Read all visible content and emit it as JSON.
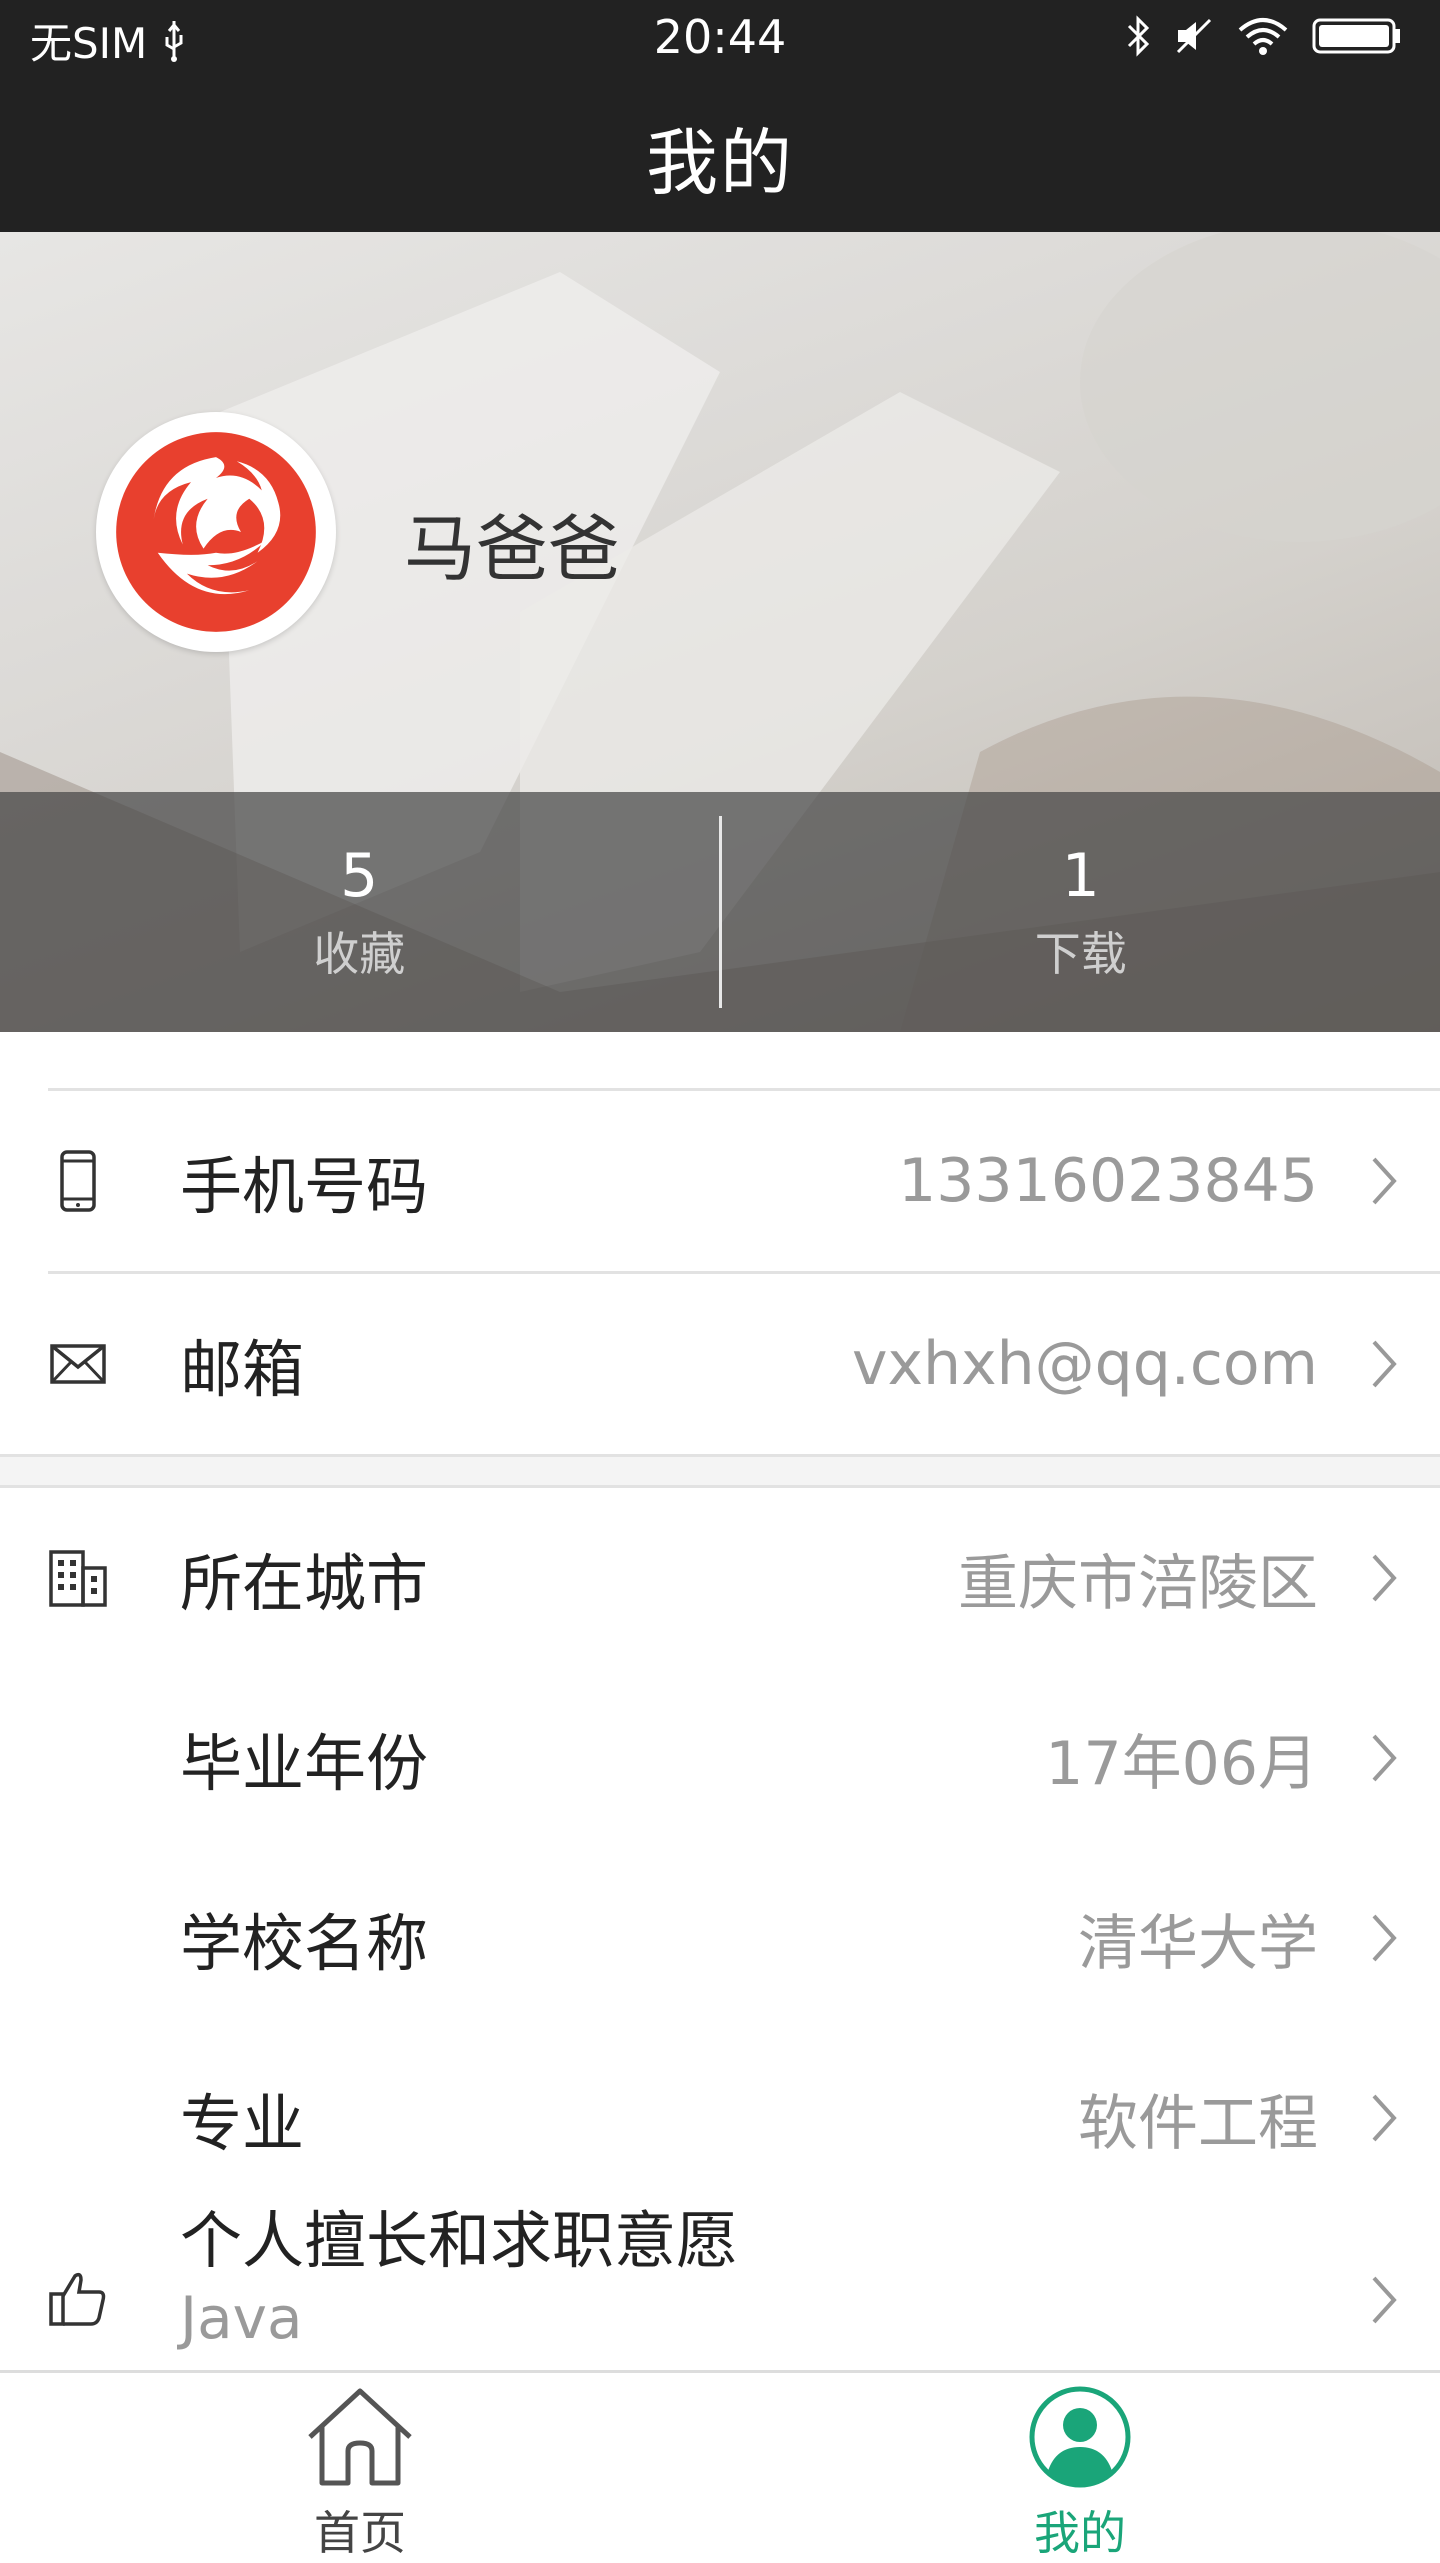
{
  "status_bar": {
    "carrier": "无SIM",
    "time": "20:44"
  },
  "title_bar": {
    "title": "我的"
  },
  "profile": {
    "username": "马爸爸",
    "stats": [
      {
        "value": "5",
        "label": "收藏"
      },
      {
        "value": "1",
        "label": "下载"
      }
    ]
  },
  "info": {
    "phone": {
      "label": "手机号码",
      "value": "13316023845"
    },
    "email": {
      "label": "邮箱",
      "value": "vxhxh@qq.com"
    },
    "city": {
      "label": "所在城市",
      "value": "重庆市涪陵区"
    },
    "graduation_year": {
      "label": "毕业年份",
      "value": "17年06月"
    },
    "school": {
      "label": "学校名称",
      "value": "清华大学"
    },
    "major": {
      "label": "专业",
      "value": "软件工程"
    },
    "skills": {
      "label": "个人擅长和求职意愿",
      "value": "Java"
    }
  },
  "tabbar": {
    "items": [
      {
        "label": "首页",
        "icon": "home-icon",
        "active": false
      },
      {
        "label": "我的",
        "icon": "profile-icon",
        "active": true
      }
    ],
    "accent_color": "#1aa579"
  }
}
